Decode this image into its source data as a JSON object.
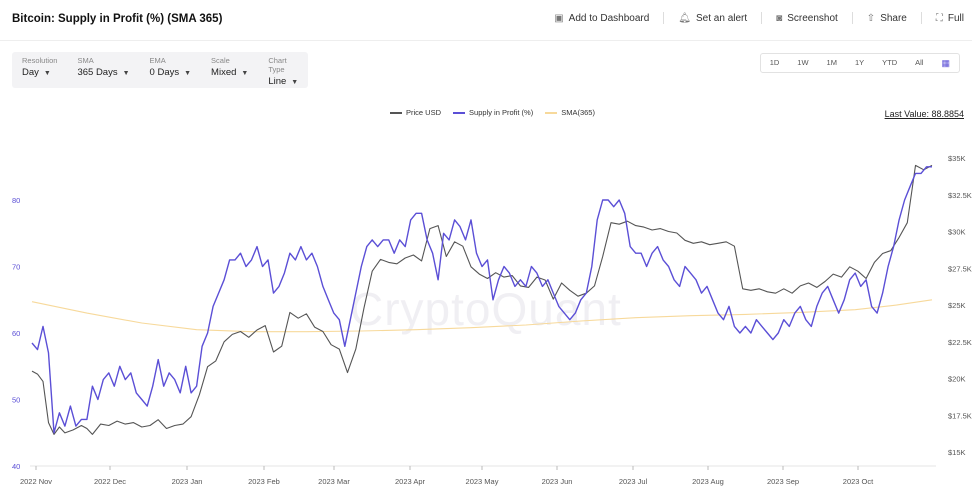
{
  "header": {
    "title": "Bitcoin: Supply in Profit (%) (SMA 365)",
    "actions": [
      {
        "label": "Add to Dashboard",
        "icon": "dashboard-icon"
      },
      {
        "label": "Set an alert",
        "icon": "bell-icon"
      },
      {
        "label": "Screenshot",
        "icon": "camera-icon"
      },
      {
        "label": "Share",
        "icon": "share-icon"
      },
      {
        "label": "Full",
        "icon": "fullscreen-icon"
      }
    ]
  },
  "controls": [
    {
      "label": "Resolution",
      "value": "Day"
    },
    {
      "label": "SMA",
      "value": "365 Days"
    },
    {
      "label": "EMA",
      "value": "0 Days"
    },
    {
      "label": "Scale",
      "value": "Mixed"
    },
    {
      "label": "Chart Type",
      "value": "Line"
    }
  ],
  "ranges": [
    "1D",
    "1W",
    "1M",
    "1Y",
    "YTD",
    "All"
  ],
  "last_value": "Last Value: 88.8854",
  "watermark": "CryptoQuant",
  "colors": {
    "price": "#555555",
    "supply": "#5b4fd6",
    "sma": "#f7d99b"
  },
  "chart_data": {
    "type": "line",
    "x_labels": [
      "2022 Nov",
      "2022 Dec",
      "2023 Jan",
      "2023 Feb",
      "2023 Mar",
      "2023 Apr",
      "2023 May",
      "2023 Jun",
      "2023 Jul",
      "2023 Aug",
      "2023 Sep",
      "2023 Oct"
    ],
    "y_left_ticks": [
      "80",
      "70",
      "60",
      "50",
      "40"
    ],
    "y_right_ticks": [
      "$35K",
      "$32.5K",
      "$30K",
      "$27.5K",
      "$25K",
      "$22.5K",
      "$20K",
      "$17.5K",
      "$15K"
    ],
    "ylim_left": [
      40,
      90
    ],
    "ylim_right": [
      15000,
      35000
    ],
    "series": [
      {
        "name": "Price USD",
        "axis": "right",
        "values": [
          [
            0,
            20500
          ],
          [
            2,
            20300
          ],
          [
            4,
            19800
          ],
          [
            6,
            17000
          ],
          [
            8,
            16200
          ],
          [
            10,
            16700
          ],
          [
            12,
            16300
          ],
          [
            15,
            16500
          ],
          [
            18,
            16800
          ],
          [
            20,
            16600
          ],
          [
            22,
            16200
          ],
          [
            25,
            16900
          ],
          [
            28,
            16800
          ],
          [
            31,
            17100
          ],
          [
            34,
            16900
          ],
          [
            37,
            17000
          ],
          [
            40,
            16700
          ],
          [
            43,
            16800
          ],
          [
            46,
            17200
          ],
          [
            49,
            16600
          ],
          [
            52,
            16800
          ],
          [
            55,
            16900
          ],
          [
            58,
            17400
          ],
          [
            61,
            18900
          ],
          [
            64,
            20800
          ],
          [
            67,
            21200
          ],
          [
            70,
            22500
          ],
          [
            73,
            23000
          ],
          [
            76,
            23200
          ],
          [
            79,
            22800
          ],
          [
            82,
            23300
          ],
          [
            85,
            23600
          ],
          [
            88,
            21800
          ],
          [
            91,
            22200
          ],
          [
            94,
            24500
          ],
          [
            97,
            24100
          ],
          [
            100,
            24400
          ],
          [
            103,
            23500
          ],
          [
            106,
            23200
          ],
          [
            109,
            22300
          ],
          [
            112,
            22000
          ],
          [
            115,
            20400
          ],
          [
            118,
            22000
          ],
          [
            121,
            24800
          ],
          [
            124,
            27300
          ],
          [
            127,
            28100
          ],
          [
            130,
            27900
          ],
          [
            133,
            27800
          ],
          [
            136,
            28200
          ],
          [
            139,
            28400
          ],
          [
            142,
            28000
          ],
          [
            145,
            30200
          ],
          [
            148,
            30400
          ],
          [
            151,
            28300
          ],
          [
            154,
            29300
          ],
          [
            157,
            29000
          ],
          [
            160,
            27600
          ],
          [
            163,
            27100
          ],
          [
            166,
            26800
          ],
          [
            169,
            27200
          ],
          [
            172,
            26900
          ],
          [
            175,
            27000
          ],
          [
            178,
            26300
          ],
          [
            181,
            26200
          ],
          [
            184,
            26900
          ],
          [
            187,
            26700
          ],
          [
            190,
            25400
          ],
          [
            193,
            26500
          ],
          [
            196,
            26000
          ],
          [
            199,
            25600
          ],
          [
            202,
            25800
          ],
          [
            205,
            26300
          ],
          [
            208,
            28300
          ],
          [
            211,
            30600
          ],
          [
            214,
            30500
          ],
          [
            217,
            30700
          ],
          [
            220,
            30400
          ],
          [
            223,
            30300
          ],
          [
            226,
            30100
          ],
          [
            229,
            30200
          ],
          [
            232,
            30000
          ],
          [
            235,
            29900
          ],
          [
            238,
            29400
          ],
          [
            241,
            29200
          ],
          [
            244,
            29300
          ],
          [
            247,
            29100
          ],
          [
            250,
            29200
          ],
          [
            253,
            29300
          ],
          [
            256,
            29000
          ],
          [
            259,
            26100
          ],
          [
            262,
            26000
          ],
          [
            265,
            26100
          ],
          [
            268,
            25900
          ],
          [
            271,
            25800
          ],
          [
            274,
            26100
          ],
          [
            277,
            25800
          ],
          [
            280,
            26300
          ],
          [
            283,
            26500
          ],
          [
            286,
            26200
          ],
          [
            289,
            26600
          ],
          [
            292,
            27100
          ],
          [
            295,
            26900
          ],
          [
            298,
            27600
          ],
          [
            301,
            27300
          ],
          [
            304,
            26800
          ],
          [
            307,
            27900
          ],
          [
            310,
            28500
          ],
          [
            313,
            28700
          ],
          [
            316,
            29600
          ],
          [
            319,
            30600
          ],
          [
            322,
            34500
          ],
          [
            325,
            34200
          ],
          [
            328,
            34500
          ]
        ]
      },
      {
        "name": "Supply in Profit (%)",
        "axis": "left",
        "values": [
          [
            0,
            58.5
          ],
          [
            2,
            57.5
          ],
          [
            4,
            61
          ],
          [
            6,
            57
          ],
          [
            8,
            45
          ],
          [
            10,
            48
          ],
          [
            12,
            46
          ],
          [
            14,
            49
          ],
          [
            16,
            46
          ],
          [
            18,
            47
          ],
          [
            20,
            47
          ],
          [
            22,
            52
          ],
          [
            24,
            50
          ],
          [
            26,
            53
          ],
          [
            28,
            54
          ],
          [
            30,
            52
          ],
          [
            32,
            55
          ],
          [
            34,
            53
          ],
          [
            36,
            54
          ],
          [
            38,
            51
          ],
          [
            40,
            50
          ],
          [
            42,
            49
          ],
          [
            44,
            52
          ],
          [
            46,
            56
          ],
          [
            48,
            52
          ],
          [
            50,
            54
          ],
          [
            52,
            53
          ],
          [
            54,
            51
          ],
          [
            56,
            55
          ],
          [
            58,
            51
          ],
          [
            60,
            52
          ],
          [
            62,
            58
          ],
          [
            64,
            60
          ],
          [
            66,
            64
          ],
          [
            68,
            66
          ],
          [
            70,
            68
          ],
          [
            72,
            71
          ],
          [
            74,
            71
          ],
          [
            76,
            72
          ],
          [
            78,
            70
          ],
          [
            80,
            71
          ],
          [
            82,
            73
          ],
          [
            84,
            70
          ],
          [
            86,
            71
          ],
          [
            88,
            66
          ],
          [
            90,
            67
          ],
          [
            92,
            69
          ],
          [
            94,
            72
          ],
          [
            96,
            71
          ],
          [
            98,
            73
          ],
          [
            100,
            71
          ],
          [
            102,
            72
          ],
          [
            104,
            70
          ],
          [
            106,
            67
          ],
          [
            108,
            65
          ],
          [
            110,
            63
          ],
          [
            112,
            62
          ],
          [
            114,
            58
          ],
          [
            116,
            62
          ],
          [
            118,
            66
          ],
          [
            120,
            70
          ],
          [
            122,
            73
          ],
          [
            124,
            74
          ],
          [
            126,
            73
          ],
          [
            128,
            74
          ],
          [
            130,
            74
          ],
          [
            132,
            72
          ],
          [
            134,
            74
          ],
          [
            136,
            73
          ],
          [
            138,
            77
          ],
          [
            140,
            78
          ],
          [
            142,
            78
          ],
          [
            144,
            74
          ],
          [
            146,
            72
          ],
          [
            148,
            68
          ],
          [
            150,
            75
          ],
          [
            152,
            74
          ],
          [
            154,
            77
          ],
          [
            156,
            76
          ],
          [
            158,
            74
          ],
          [
            160,
            77
          ],
          [
            162,
            72
          ],
          [
            164,
            70
          ],
          [
            166,
            71
          ],
          [
            168,
            65
          ],
          [
            170,
            68
          ],
          [
            172,
            70
          ],
          [
            174,
            69
          ],
          [
            176,
            67
          ],
          [
            178,
            68
          ],
          [
            180,
            67
          ],
          [
            182,
            70
          ],
          [
            184,
            69
          ],
          [
            186,
            67
          ],
          [
            188,
            68
          ],
          [
            190,
            66
          ],
          [
            192,
            64
          ],
          [
            194,
            63
          ],
          [
            196,
            62
          ],
          [
            198,
            63
          ],
          [
            200,
            65
          ],
          [
            202,
            66
          ],
          [
            204,
            70
          ],
          [
            206,
            77
          ],
          [
            208,
            80
          ],
          [
            210,
            80
          ],
          [
            212,
            79
          ],
          [
            214,
            80
          ],
          [
            216,
            78
          ],
          [
            218,
            73
          ],
          [
            220,
            72
          ],
          [
            222,
            72
          ],
          [
            224,
            70
          ],
          [
            226,
            72
          ],
          [
            228,
            73
          ],
          [
            230,
            71
          ],
          [
            232,
            70
          ],
          [
            234,
            68
          ],
          [
            236,
            67
          ],
          [
            238,
            70
          ],
          [
            240,
            69
          ],
          [
            242,
            68
          ],
          [
            244,
            66
          ],
          [
            246,
            67
          ],
          [
            248,
            65
          ],
          [
            250,
            63
          ],
          [
            252,
            62
          ],
          [
            254,
            64
          ],
          [
            256,
            61
          ],
          [
            258,
            60
          ],
          [
            260,
            61
          ],
          [
            262,
            60
          ],
          [
            264,
            62
          ],
          [
            266,
            61
          ],
          [
            268,
            60
          ],
          [
            270,
            59
          ],
          [
            272,
            60
          ],
          [
            274,
            62
          ],
          [
            276,
            61
          ],
          [
            278,
            63
          ],
          [
            280,
            64
          ],
          [
            282,
            62
          ],
          [
            284,
            61
          ],
          [
            286,
            64
          ],
          [
            288,
            66
          ],
          [
            290,
            67
          ],
          [
            292,
            65
          ],
          [
            294,
            63
          ],
          [
            296,
            65
          ],
          [
            298,
            68
          ],
          [
            300,
            69
          ],
          [
            302,
            67
          ],
          [
            304,
            68
          ],
          [
            306,
            64
          ],
          [
            308,
            63
          ],
          [
            310,
            66
          ],
          [
            312,
            70
          ],
          [
            314,
            73
          ],
          [
            316,
            77
          ],
          [
            318,
            80
          ],
          [
            320,
            82
          ],
          [
            322,
            84
          ],
          [
            324,
            84
          ],
          [
            326,
            85
          ],
          [
            328,
            85
          ]
        ]
      },
      {
        "name": "SMA(365)",
        "axis": "left",
        "values": [
          [
            0,
            64.7
          ],
          [
            20,
            63
          ],
          [
            40,
            61.5
          ],
          [
            60,
            60.5
          ],
          [
            80,
            60.2
          ],
          [
            100,
            60.2
          ],
          [
            120,
            60.3
          ],
          [
            140,
            60.5
          ],
          [
            160,
            60.8
          ],
          [
            180,
            61.2
          ],
          [
            200,
            61.8
          ],
          [
            220,
            62.3
          ],
          [
            240,
            62.6
          ],
          [
            260,
            62.8
          ],
          [
            280,
            63.1
          ],
          [
            300,
            63.5
          ],
          [
            315,
            64.2
          ],
          [
            328,
            65.0
          ]
        ]
      }
    ]
  }
}
